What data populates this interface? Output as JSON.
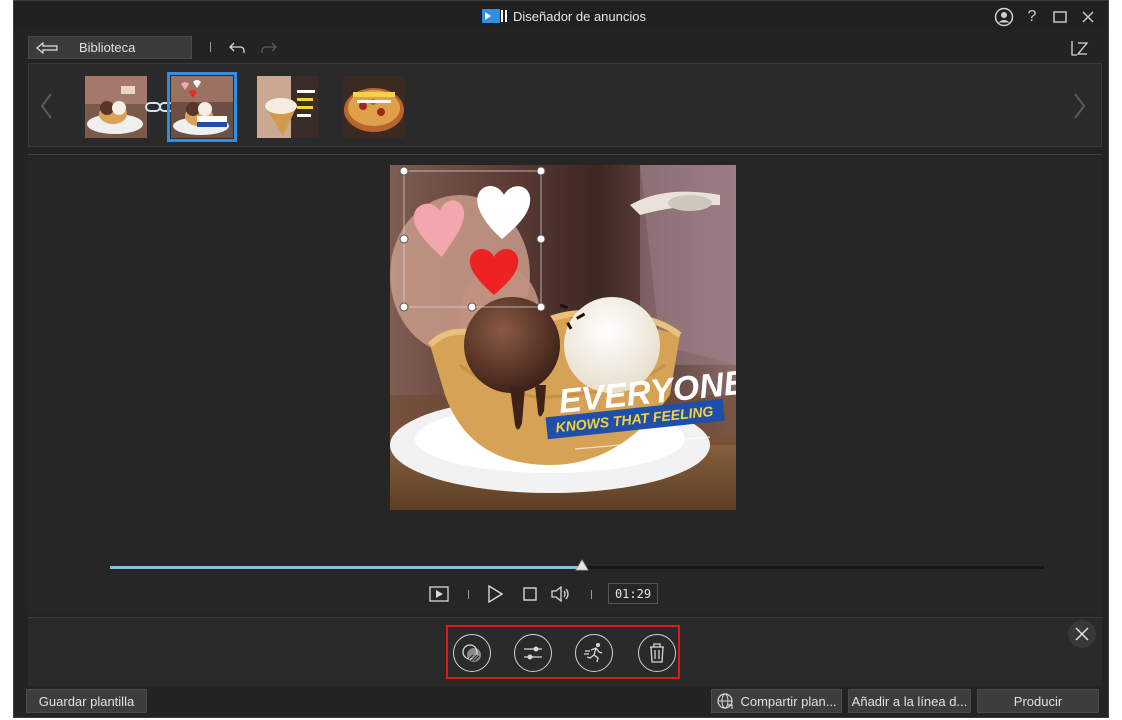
{
  "window": {
    "title": "Diseñador de anuncios",
    "controls": [
      "account-icon",
      "help-icon",
      "maximize-icon",
      "close-icon"
    ]
  },
  "toolbar": {
    "library_label": "Biblioteca",
    "undo_icon": "undo-icon",
    "redo_icon": "redo-icon",
    "redo_enabled": false
  },
  "thumbnails": [
    {
      "name": "scene-1",
      "selected": false
    },
    {
      "name": "scene-2",
      "selected": true
    },
    {
      "name": "scene-3",
      "selected": false
    },
    {
      "name": "scene-4",
      "selected": false
    }
  ],
  "preview": {
    "overlay_title": "EVERYONE",
    "overlay_subtitle": "KNOWS THAT FEELING",
    "hearts": [
      "pink",
      "white",
      "red"
    ]
  },
  "playback": {
    "progress": 0.505,
    "timecode": "01:29"
  },
  "actions": [
    "mask-icon",
    "adjust-icon",
    "motion-icon",
    "trash-icon"
  ],
  "footer": {
    "save_template": "Guardar plantilla",
    "share": "Compartir plan...",
    "add_to_timeline": "Añadir a la línea d...",
    "produce": "Producir"
  },
  "colors": {
    "accent": "#2f8fe8",
    "highlight_box": "#e01a1a",
    "scrub_fill": "#7fc2e8",
    "background": "#232323"
  }
}
